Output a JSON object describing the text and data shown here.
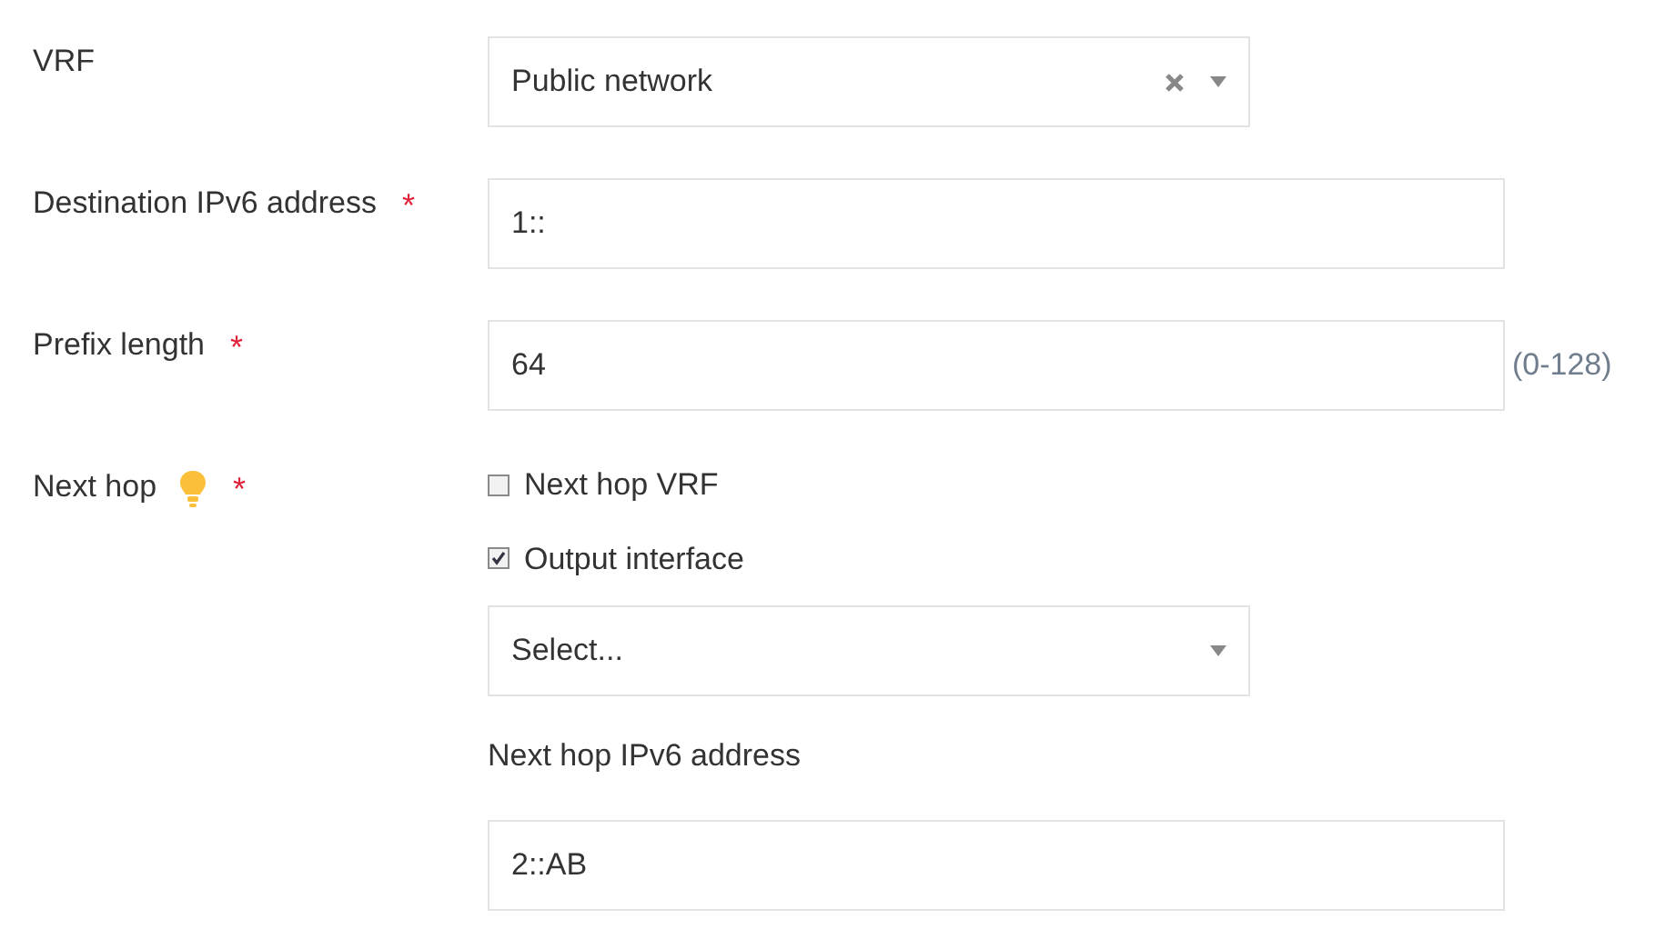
{
  "fields": [
    {
      "kind": "select",
      "label": "VRF",
      "value": "Public network",
      "clearable": true
    },
    {
      "kind": "text",
      "label": "Destination IPv6 address",
      "required_mark": "*",
      "value": "1::"
    },
    {
      "kind": "text",
      "label": "Prefix length",
      "required_mark": "*",
      "value": "64",
      "hint": "(0-128)"
    },
    {
      "kind": "group",
      "label": "Next hop",
      "required_mark": "*",
      "info_icon": true,
      "options": [
        {
          "label": "Next hop VRF",
          "checked": false
        },
        {
          "label": "Output interface",
          "checked": true
        }
      ],
      "interface_select": {
        "placeholder": "Select..."
      },
      "address": {
        "label": "Next hop IPv6 address",
        "value": "2::AB"
      }
    }
  ]
}
